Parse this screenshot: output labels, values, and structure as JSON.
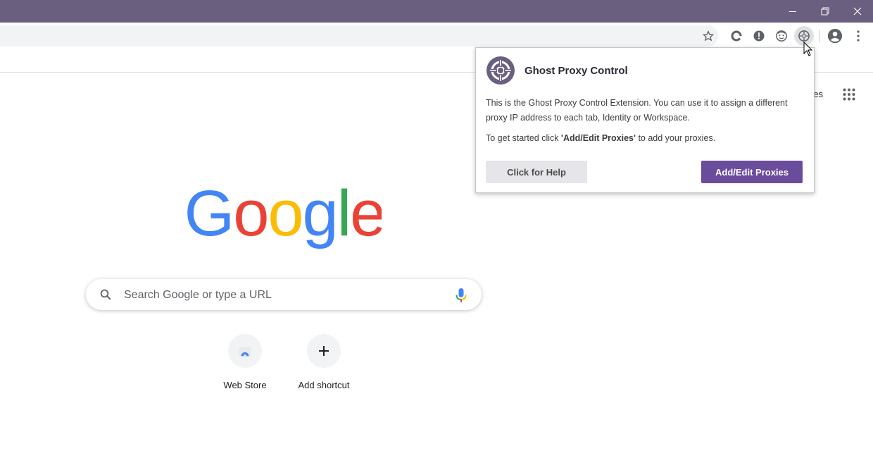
{
  "window": {
    "minimize_icon": "minimize-icon",
    "restore_icon": "restore-icon",
    "close_icon": "close-icon",
    "titlebar_color": "#6a5f7e"
  },
  "toolbar": {
    "icons": [
      "bookmark-star-icon",
      "extension-refresh-icon",
      "extension-alert-icon",
      "extension-face-icon",
      "ghost-proxy-icon",
      "profile-icon",
      "menu-dots-icon"
    ]
  },
  "ntp": {
    "apps_link_partial": "ges",
    "logo_letters": [
      "G",
      "o",
      "o",
      "g",
      "l",
      "e"
    ],
    "logo_colors": [
      "#4285F4",
      "#EA4335",
      "#FBBC05",
      "#4285F4",
      "#34A853",
      "#EA4335"
    ],
    "search": {
      "placeholder": "Search Google or type a URL"
    },
    "shortcuts": [
      {
        "label": "Web Store"
      },
      {
        "label": "Add shortcut"
      }
    ]
  },
  "popup": {
    "title": "Ghost Proxy Control",
    "paragraph1": "This is the Ghost Proxy Control Extension. You can use it to assign a different proxy IP address to each tab, Identity or Workspace.",
    "paragraph2_pre": "To get started click ",
    "paragraph2_bold": "'Add/Edit Proxies'",
    "paragraph2_post": " to add your proxies.",
    "help_button": "Click for Help",
    "add_button": "Add/Edit Proxies",
    "accent_color": "#6a4c9c"
  }
}
